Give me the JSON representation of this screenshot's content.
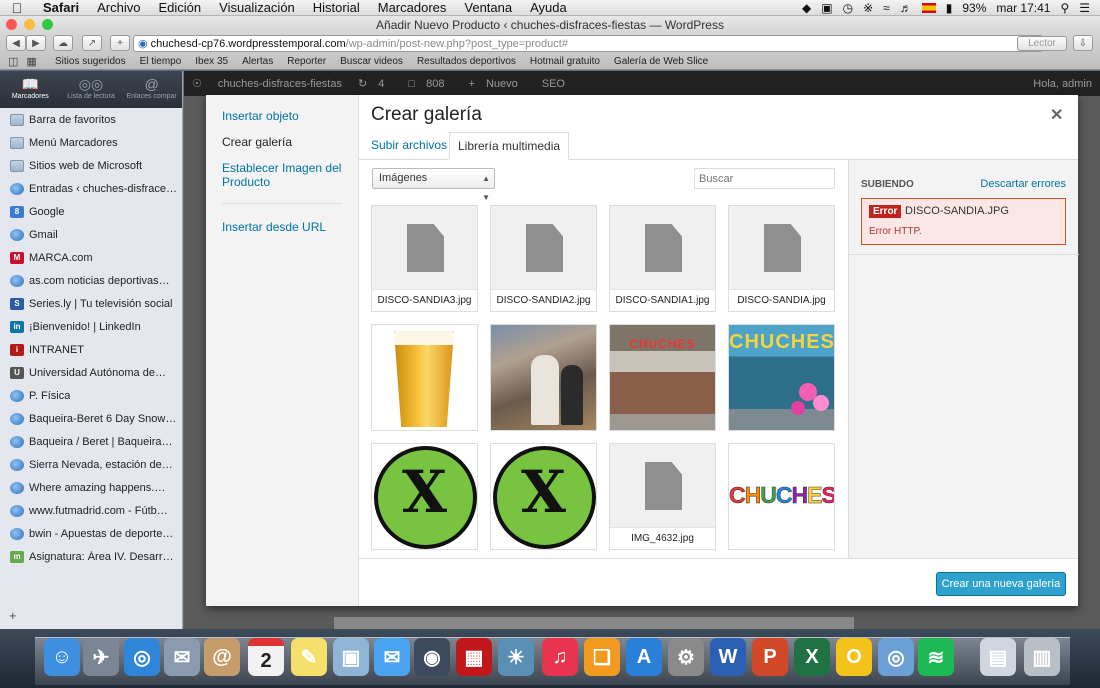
{
  "menubar": {
    "app": "Safari",
    "items": [
      "Archivo",
      "Edición",
      "Visualización",
      "Historial",
      "Marcadores",
      "Ventana",
      "Ayuda"
    ],
    "battery": "93%",
    "clock": "mar 17:41"
  },
  "window": {
    "title": "Añadir Nuevo Producto ‹ chuches-disfraces-fiestas — WordPress"
  },
  "toolbar": {
    "url_domain": "chuchesd-cp76.wordpresstemporal.com",
    "url_path": "/wp-admin/post-new.php?post_type=product#",
    "reader_label": "Lector"
  },
  "favorites_bar": [
    "Sitios sugeridos",
    "El tiempo",
    "Ibex 35",
    "Alertas",
    "Reporter",
    "Buscar videos",
    "Resultados deportivos",
    "Hotmail gratuito",
    "Galería de Web Slice"
  ],
  "sidebar": {
    "tabs": [
      "Marcadores",
      "Lista de lectura",
      "Enlaces compar"
    ],
    "bookmarks": [
      {
        "label": "Barra de favoritos",
        "icon": "folder-icon"
      },
      {
        "label": "Menú Marcadores",
        "icon": "folder-icon"
      },
      {
        "label": "Sitios web de Microsoft",
        "icon": "folder-icon"
      },
      {
        "label": "Entradas ‹ chuches-disfrace…",
        "icon": "globe-icon"
      },
      {
        "label": "Google",
        "icon": "google-icon"
      },
      {
        "label": "Gmail",
        "icon": "globe-icon"
      },
      {
        "label": "MARCA.com",
        "icon": "marca-icon"
      },
      {
        "label": "as.com noticias deportivas…",
        "icon": "globe-icon"
      },
      {
        "label": "Series.ly | Tu televisión social",
        "icon": "seriesly-icon"
      },
      {
        "label": "¡Bienvenido! | LinkedIn",
        "icon": "linkedin-icon"
      },
      {
        "label": "INTRANET",
        "icon": "intranet-icon"
      },
      {
        "label": "Universidad Autónoma de…",
        "icon": "uam-icon"
      },
      {
        "label": "P. Física",
        "icon": "globe-icon"
      },
      {
        "label": "Baqueira-Beret 6 Day Snow…",
        "icon": "globe-icon"
      },
      {
        "label": "Baqueira / Beret | Baqueira…",
        "icon": "globe-icon"
      },
      {
        "label": "Sierra Nevada, estación de…",
        "icon": "globe-icon"
      },
      {
        "label": "Where amazing happens.…",
        "icon": "globe-icon"
      },
      {
        "label": "www.futmadrid.com - Fútb…",
        "icon": "globe-icon"
      },
      {
        "label": "bwin - Apuestas de deporte…",
        "icon": "globe-icon"
      },
      {
        "label": "Asignatura: Área IV. Desarr…",
        "icon": "moodle-icon"
      }
    ]
  },
  "wp_adminbar": {
    "site": "chuches-disfraces-fiestas",
    "updates": "4",
    "comments": "808",
    "new": "Nuevo",
    "seo": "SEO",
    "greeting": "Hola, admin"
  },
  "modal": {
    "title": "Crear galería",
    "menu": [
      "Insertar objeto",
      "Crear galería",
      "Establecer Imagen del Producto",
      "Insertar desde URL"
    ],
    "tabs": [
      "Subir archivos",
      "Librería multimedia"
    ],
    "filter_value": "Imágenes",
    "search_placeholder": "Buscar",
    "attachments": [
      {
        "kind": "file",
        "filename": "DISCO-SANDIA3.jpg"
      },
      {
        "kind": "file",
        "filename": "DISCO-SANDIA2.jpg"
      },
      {
        "kind": "file",
        "filename": "DISCO-SANDIA1.jpg"
      },
      {
        "kind": "file",
        "filename": "DISCO-SANDIA.jpg"
      },
      {
        "kind": "image",
        "subject": "beer-glass"
      },
      {
        "kind": "image",
        "subject": "store-interior"
      },
      {
        "kind": "image",
        "subject": "store-front"
      },
      {
        "kind": "image",
        "subject": "store-front-balloons"
      },
      {
        "kind": "image",
        "subject": "gluten-free-symbol"
      },
      {
        "kind": "image",
        "subject": "gluten-free-symbol"
      },
      {
        "kind": "file",
        "filename": "IMG_4632.jpg"
      },
      {
        "kind": "image",
        "subject": "chuches-logo"
      }
    ],
    "sign_text": "CHUCHES",
    "upload_panel": {
      "heading": "Subiendo",
      "dismiss": "Descartar errores",
      "error_badge": "Error",
      "error_file": "DISCO-SANDIA.JPG",
      "error_message": "Error HTTP."
    },
    "primary_button": "Crear una nueva galería"
  },
  "dock": {
    "calendar_day": "2"
  }
}
